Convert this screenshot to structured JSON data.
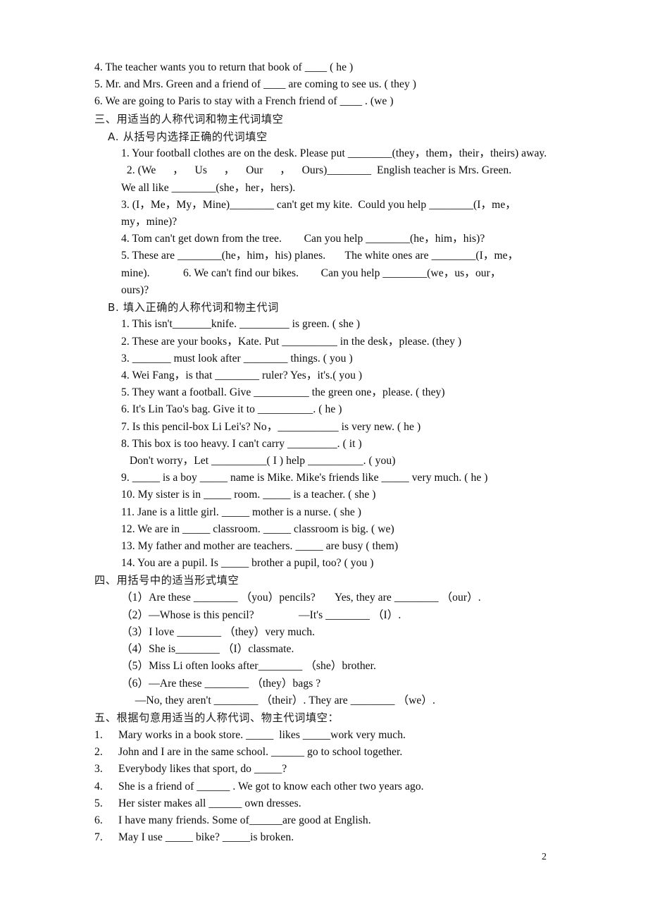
{
  "document": {
    "page_number": "2",
    "sections": [
      {
        "id": "section-two-tail",
        "lines": [
          {
            "indent": "lv0",
            "text": "4. The teacher wants you to return that book of ____ ( he )"
          },
          {
            "indent": "lv0",
            "text": "5. Mr. and Mrs. Green and a friend of ____ are coming to see us. ( they )"
          },
          {
            "indent": "lv0",
            "text": "6. We are going to Paris to stay with a French friend of ____ . (we )"
          }
        ]
      },
      {
        "id": "section-three",
        "heading": "三、用适当的人称代词和物主代词填空",
        "subsections": [
          {
            "id": "sub-a",
            "heading": "A. 从括号内选择正确的代词填空",
            "lines": [
              {
                "indent": "lv2",
                "text": "1. Your football clothes are on the desk. Please put ________(they，them，their，theirs) away."
              },
              {
                "indent": "lv2",
                "text": "  2. (We      ，    Us      ，    Our      ，    Ours)________  English teacher is Mrs. Green."
              },
              {
                "indent": "lv2",
                "text": "We all like ________(she，her，hers)."
              },
              {
                "indent": "lv2",
                "text": "3. (I，Me，My，Mine)________ can't get my kite.  Could you help ________(I，me，"
              },
              {
                "indent": "lv2",
                "text": "my，mine)?"
              },
              {
                "indent": "lv2",
                "text": "4. Tom can't get down from the tree.        Can you help ________(he，him，his)?"
              },
              {
                "indent": "lv2",
                "text": "5. These are ________(he，him，his) planes.       The white ones are ________(I，me，"
              },
              {
                "indent": "lv2",
                "text": "mine).            6. We can't find our bikes.        Can you help ________(we，us，our，"
              },
              {
                "indent": "lv2",
                "text": "ours)?"
              }
            ]
          },
          {
            "id": "sub-b",
            "heading": "B. 填入正确的人称代词和物主代词",
            "lines": [
              {
                "indent": "lv2",
                "text": "1. This isn't_______knife. _________ is green. ( she )"
              },
              {
                "indent": "lv2",
                "text": "2. These are your books，Kate. Put __________ in the desk，please. (they )"
              },
              {
                "indent": "lv2",
                "text": "3. _______ must look after ________ things. ( you )"
              },
              {
                "indent": "lv2",
                "text": "4. Wei Fang，is that ________ ruler? Yes，it's.( you )"
              },
              {
                "indent": "lv2",
                "text": "5. They want a football. Give __________ the green one，please. ( they)"
              },
              {
                "indent": "lv2",
                "text": "6. It's Lin Tao's bag. Give it to __________. ( he )"
              },
              {
                "indent": "lv2",
                "text": "7. Is this pencil-box Li Lei's? No，___________ is very new. ( he )"
              },
              {
                "indent": "lv2",
                "text": "8. This box is too heavy. I can't carry _________. ( it )"
              },
              {
                "indent": "lv2",
                "text": "   Don't worry，Let __________( I ) help __________. ( you)"
              },
              {
                "indent": "lv2",
                "text": "9. _____ is a boy _____ name is Mike. Mike's friends like _____ very much. ( he )"
              },
              {
                "indent": "lv2",
                "text": "10. My sister is in _____ room. _____ is a teacher. ( she )"
              },
              {
                "indent": "lv2",
                "text": "11. Jane is a little girl. _____ mother is a nurse. ( she )"
              },
              {
                "indent": "lv2",
                "text": "12. We are in _____ classroom. _____ classroom is big. ( we)"
              },
              {
                "indent": "lv2",
                "text": "13. My father and mother are teachers. _____ are busy ( them)"
              },
              {
                "indent": "lv2",
                "text": "14. You are a pupil. Is _____ brother a pupil, too? ( you )"
              }
            ]
          }
        ]
      },
      {
        "id": "section-four",
        "heading": "四、用括号中的适当形式填空",
        "lines": [
          {
            "indent": "lv2",
            "text": "（1）Are these ________ （you）pencils?       Yes, they are ________ （our）."
          },
          {
            "indent": "lv2",
            "text": "（2）—Whose is this pencil?                —It's ________ （I）."
          },
          {
            "indent": "lv2",
            "text": "（3）I love ________ （they）very much."
          },
          {
            "indent": "lv2",
            "text": "（4）She is________ （I）classmate."
          },
          {
            "indent": "lv2",
            "text": "（5）Miss Li often looks after________ （she）brother."
          },
          {
            "indent": "lv2",
            "text": "（6）—Are these ________ （they）bags ?"
          },
          {
            "indent": "lv2",
            "text": "     —No, they aren't ________ （their）. They are ________ （we）."
          }
        ]
      },
      {
        "id": "section-five",
        "heading": "五、根据句意用适当的人称代词、物主代词填空：",
        "items": [
          {
            "num": "1.",
            "text": "Mary works in a book store. _____  likes _____work very much."
          },
          {
            "num": "2.",
            "text": "John and I are in the same school. ______ go to school together."
          },
          {
            "num": "3.",
            "text": "Everybody likes that sport, do _____?"
          },
          {
            "num": "4.",
            "text": "She is a friend of ______ . We got to know each other two years ago."
          },
          {
            "num": "5.",
            "text": "Her sister makes all ______ own dresses."
          },
          {
            "num": "6.",
            "text": "I have many friends. Some of______are good at English."
          },
          {
            "num": "7.",
            "text": "May I use _____ bike? _____is broken."
          }
        ]
      }
    ]
  }
}
